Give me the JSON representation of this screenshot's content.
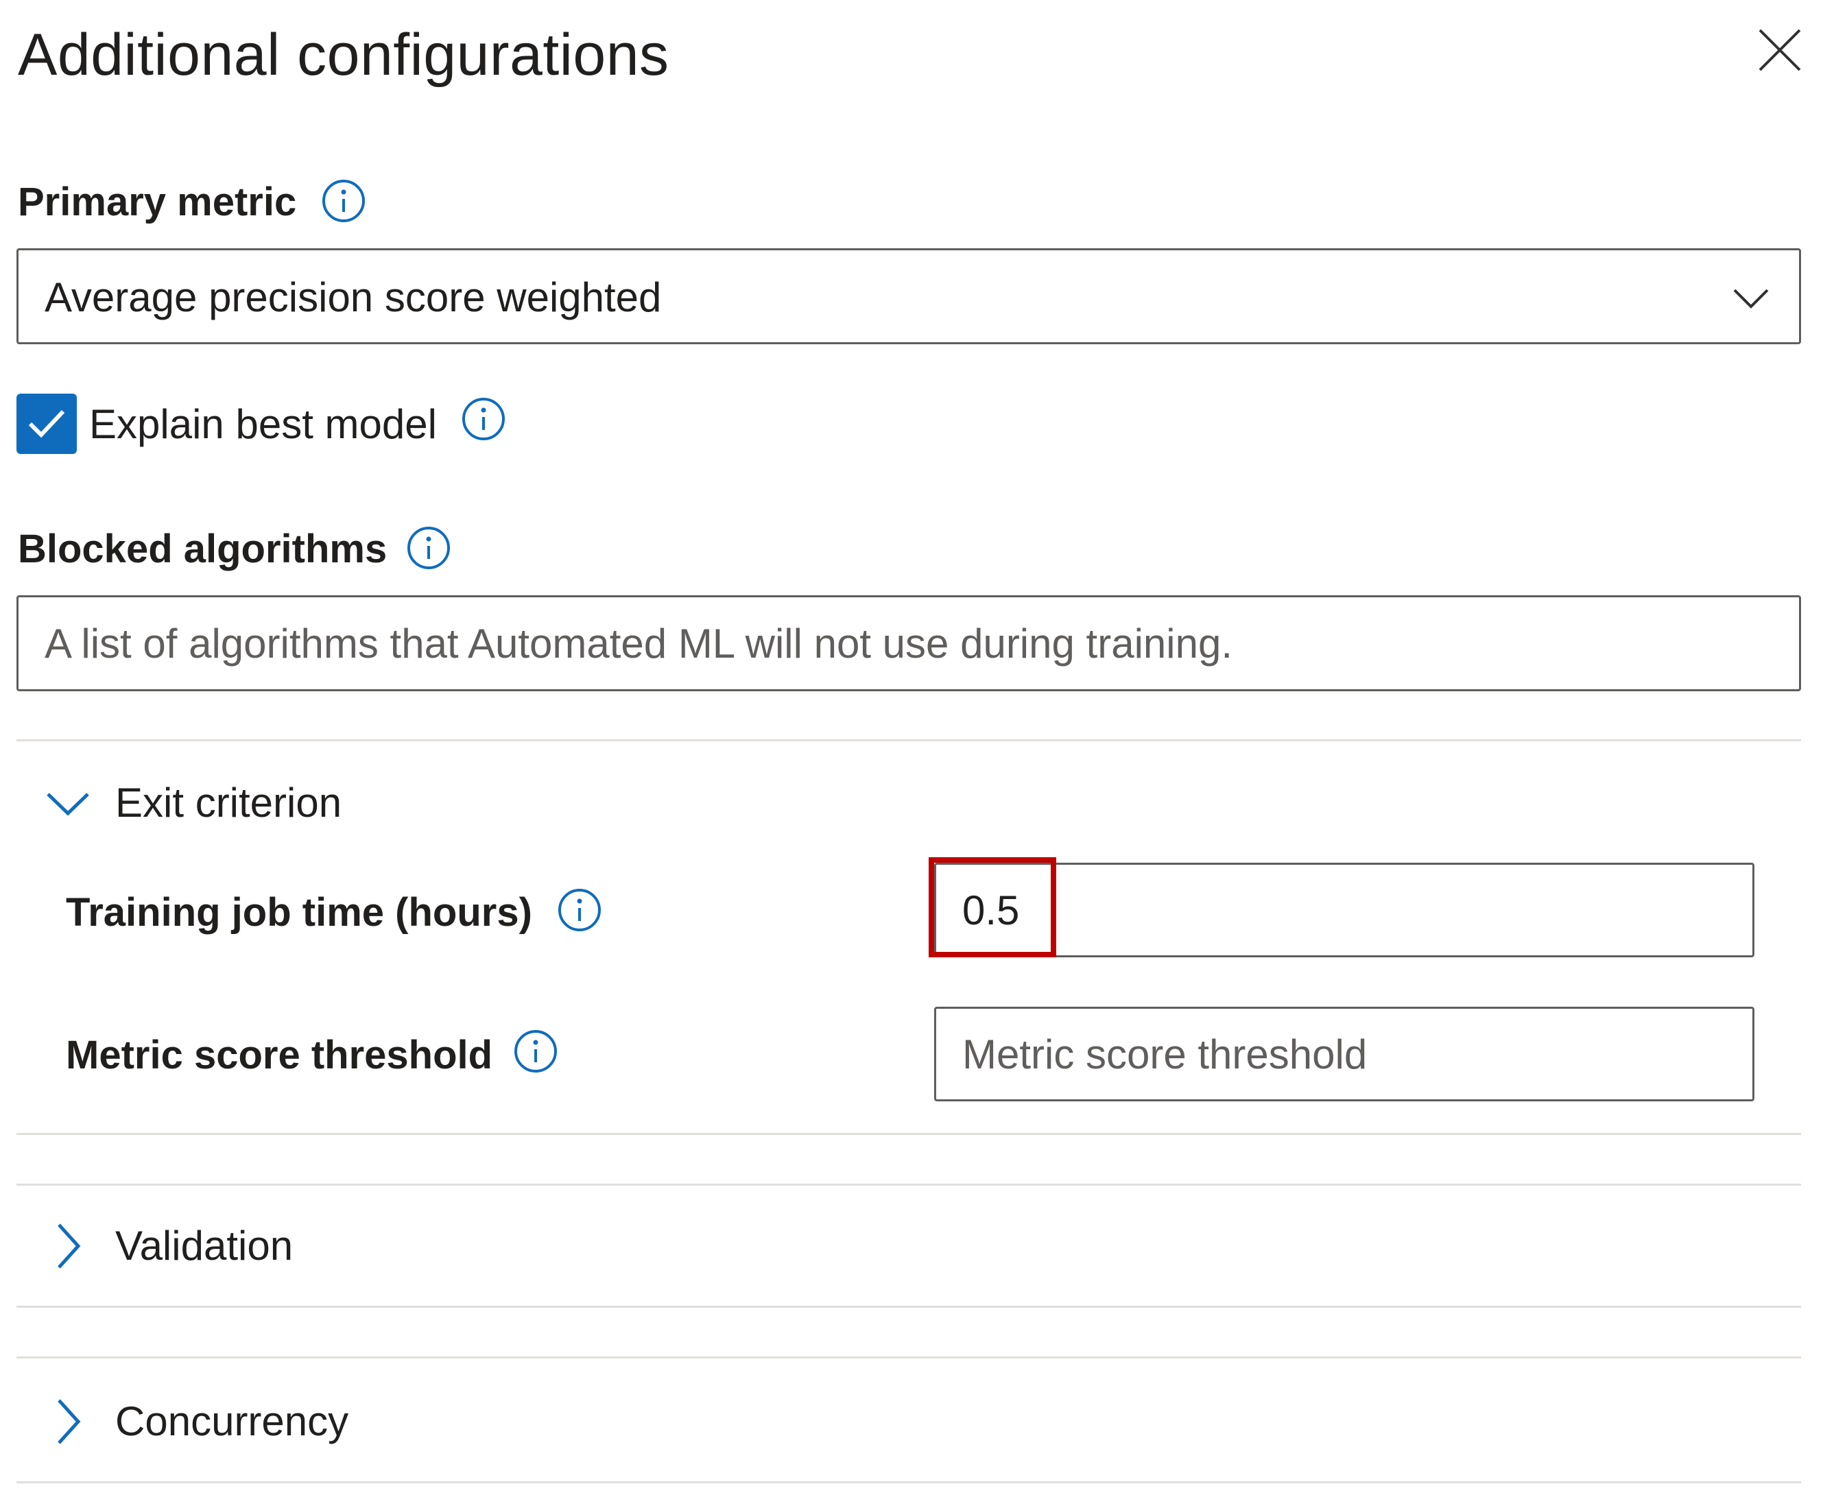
{
  "panel": {
    "title": "Additional configurations",
    "close_icon": "close-icon"
  },
  "primary_metric": {
    "label": "Primary metric",
    "value": "Average precision score weighted"
  },
  "explain_best_model": {
    "label": "Explain best model",
    "checked": true
  },
  "blocked_algorithms": {
    "label": "Blocked algorithms",
    "placeholder": "A list of algorithms that Automated ML will not use during training."
  },
  "exit_criterion": {
    "label": "Exit criterion",
    "expanded": true,
    "training_job_time": {
      "label": "Training job time (hours)",
      "value": "0.5"
    },
    "metric_score_threshold": {
      "label": "Metric score threshold",
      "placeholder": "Metric score threshold"
    }
  },
  "validation": {
    "label": "Validation",
    "expanded": false
  },
  "concurrency": {
    "label": "Concurrency",
    "expanded": false
  },
  "colors": {
    "accent": "#0f6cbd",
    "highlight": "#c00000",
    "border": "#605e5c",
    "divider": "#e1dfdd"
  }
}
